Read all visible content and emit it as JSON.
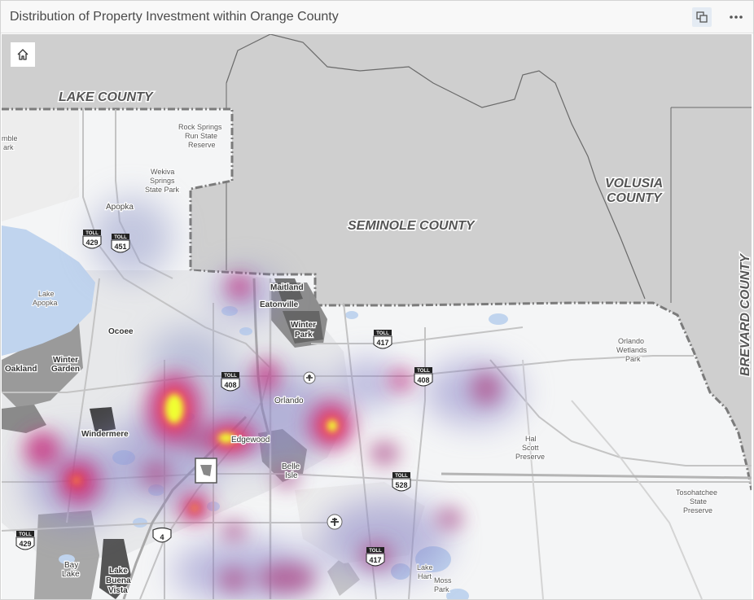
{
  "header": {
    "title": "Distribution of Property Investment within Orange County",
    "maximize_icon": "maximize-icon",
    "more_icon": "more-options-icon"
  },
  "map": {
    "home_icon": "home-icon",
    "counties": {
      "lake": "LAKE COUNTY",
      "seminole": "SEMINOLE  COUNTY",
      "volusia_1": "VOLUSIA",
      "volusia_2": "COUNTY",
      "brevard": "BREVARD COUNTY"
    },
    "places": {
      "apopka": "Apopka",
      "maitland": "Maitland",
      "eatonville": "Eatonville",
      "winter_park_1": "Winter",
      "winter_park_2": "Park",
      "ocoee": "Ocoee",
      "winter_garden_1": "Winter",
      "winter_garden_2": "Garden",
      "oakland": "Oakland",
      "orlando": "Orlando",
      "windermere": "Windermere",
      "edgewood": "Edgewood",
      "belle_isle_1": "Belle",
      "belle_isle_2": "Isle",
      "bay_lake_1": "Bay",
      "bay_lake_2": "Lake",
      "lake_buena_vista_1": "Lake",
      "lake_buena_vista_2": "Buena",
      "lake_buena_vista_3": "Vista"
    },
    "features": {
      "rock_springs_1": "Rock Springs",
      "rock_springs_2": "Run State",
      "rock_springs_3": "Reserve",
      "wekiva_1": "Wekiva",
      "wekiva_2": "Springs",
      "wekiva_3": "State Park",
      "lake_apopka_1": "Lake",
      "lake_apopka_2": "Apopka",
      "orlando_wetlands_1": "Orlando",
      "orlando_wetlands_2": "Wetlands",
      "orlando_wetlands_3": "Park",
      "hal_scott_1": "Hal",
      "hal_scott_2": "Scott",
      "hal_scott_3": "Preserve",
      "tosohatchee_1": "Tosohatchee",
      "tosohatchee_2": "State",
      "tosohatchee_3": "Preserve",
      "lake_hart_1": "Lake",
      "lake_hart_2": "Hart",
      "moss_park_1": "Moss",
      "moss_park_2": "Park",
      "edge_1": "mble",
      "edge_2": "ark"
    },
    "shields": {
      "toll": "TOLL",
      "r429": "429",
      "r451": "451",
      "r417": "417",
      "r408": "408",
      "r528": "528",
      "i4": "4"
    },
    "colors": {
      "land_outside": "#cfcfcf",
      "land_inside": "#f4f5f6",
      "water": "#c0d4ee",
      "heat_low": "#8a86c8",
      "heat_mid": "#c8317f",
      "heat_high": "#f0ff30"
    }
  }
}
